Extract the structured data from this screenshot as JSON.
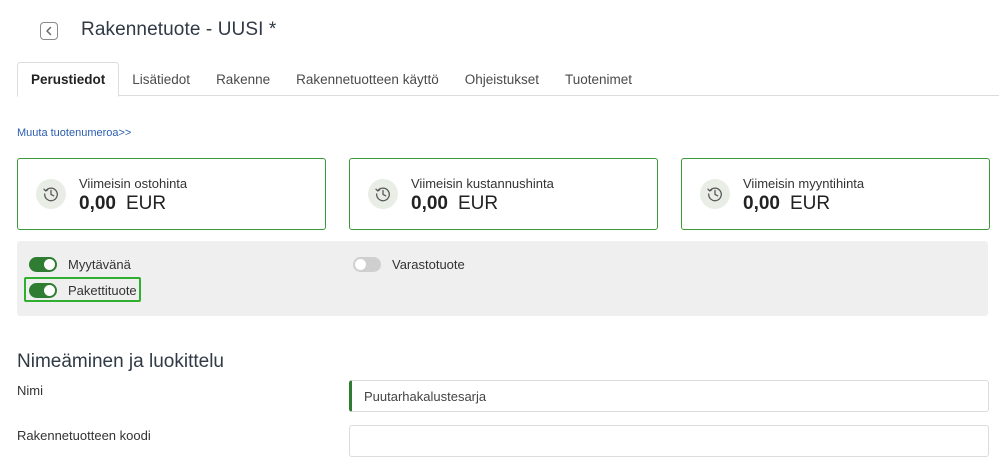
{
  "header": {
    "title": "Rakennetuote - UUSI *",
    "back_icon": "chevron-left-icon"
  },
  "tabs": [
    {
      "label": "Perustiedot",
      "active": true
    },
    {
      "label": "Lisätiedot",
      "active": false
    },
    {
      "label": "Rakenne",
      "active": false
    },
    {
      "label": "Rakennetuotteen käyttö",
      "active": false
    },
    {
      "label": "Ohjeistukset",
      "active": false
    },
    {
      "label": "Tuotenimet",
      "active": false
    }
  ],
  "change_number_link": "Muuta tuotenumeroa>>",
  "price_cards": [
    {
      "label": "Viimeisin ostohinta",
      "amount": "0,00",
      "currency": "EUR",
      "icon": "history-clock-icon"
    },
    {
      "label": "Viimeisin kustannushinta",
      "amount": "0,00",
      "currency": "EUR",
      "icon": "history-clock-icon"
    },
    {
      "label": "Viimeisin myyntihinta",
      "amount": "0,00",
      "currency": "EUR",
      "icon": "history-clock-icon"
    }
  ],
  "toggles": {
    "myytava": {
      "label": "Myytävänä",
      "on": true
    },
    "pakettituote": {
      "label": "Pakettituote",
      "on": true
    },
    "varastotuote": {
      "label": "Varastotuote",
      "on": false
    }
  },
  "section": {
    "title": "Nimeäminen ja luokittelu"
  },
  "fields": {
    "nimi": {
      "label": "Nimi",
      "value": "Puutarhakalustesarja"
    },
    "koodi": {
      "label": "Rakennetuotteen koodi",
      "value": ""
    }
  },
  "colors": {
    "accent": "#2e7d32",
    "card_border": "#3a9a3a",
    "focus": "#2fae2f",
    "link": "#2a5db0"
  }
}
